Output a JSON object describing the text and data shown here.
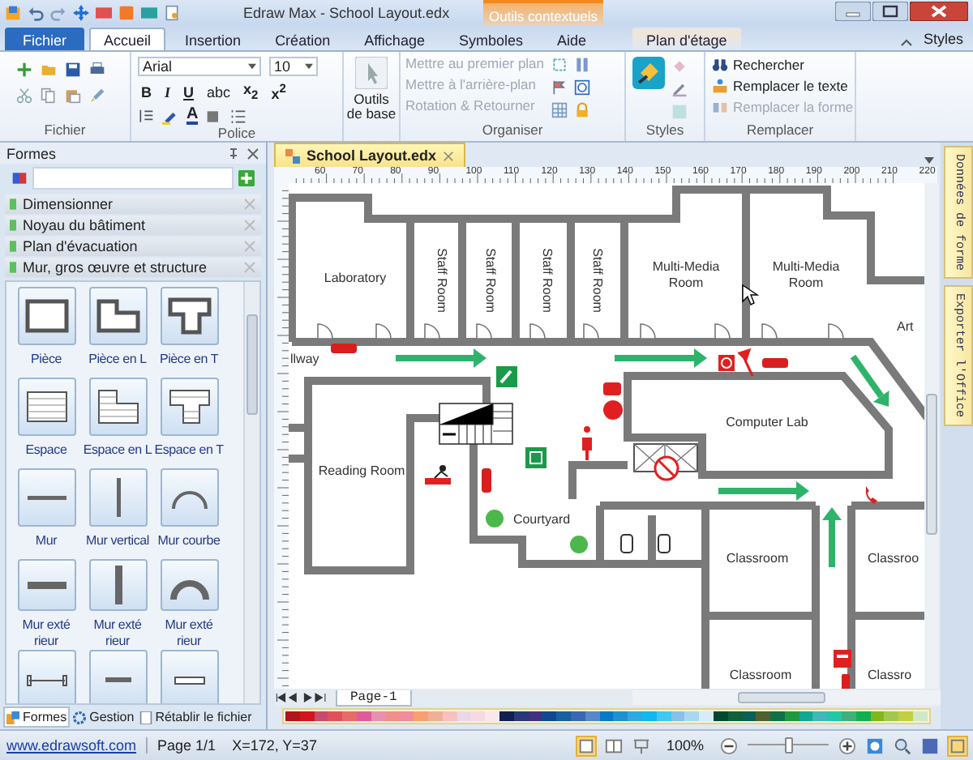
{
  "window": {
    "title": "Edraw Max - School Layout.edx",
    "context_label": "Outils contextuels"
  },
  "tabs": [
    {
      "label": "Fichier",
      "kind": "file",
      "selected": false
    },
    {
      "label": "Accueil",
      "kind": "tab",
      "selected": true
    },
    {
      "label": "Insertion",
      "kind": "tab",
      "selected": false
    },
    {
      "label": "Création",
      "kind": "tab",
      "selected": false
    },
    {
      "label": "Affichage",
      "kind": "tab",
      "selected": false
    },
    {
      "label": "Symboles",
      "kind": "tab",
      "selected": false
    },
    {
      "label": "Aide",
      "kind": "tab",
      "selected": false
    },
    {
      "label": "Plan d'étage",
      "kind": "context",
      "selected": false
    }
  ],
  "styles_button": "Styles",
  "ribbon": {
    "fichier": {
      "label": "Fichier"
    },
    "police": {
      "label": "Police",
      "font": "Arial",
      "size": "10",
      "format": [
        "B",
        "I",
        "U",
        "abc",
        "x$_{2}$",
        "x$^{2}$"
      ],
      "font_color": "A"
    },
    "outils": {
      "label": "Outils de base"
    },
    "organiser": {
      "label": "Organiser",
      "items": [
        {
          "label": "Mettre au premier plan",
          "disabled": true
        },
        {
          "label": "Mettre à l'arrière-plan",
          "disabled": true
        },
        {
          "label": "Rotation & Retourner",
          "disabled": true
        }
      ]
    },
    "styles": {
      "label": "Styles"
    },
    "remplacer": {
      "label": "Remplacer",
      "items": [
        {
          "label": "Rechercher",
          "disabled": false
        },
        {
          "label": "Remplacer le texte",
          "disabled": false
        },
        {
          "label": "Remplacer la forme",
          "disabled": true
        }
      ]
    }
  },
  "shapes_panel": {
    "title": "Formes",
    "categories": [
      "Dimensionner",
      "Noyau du bâtiment",
      "Plan d'évacuation",
      "Mur, gros œuvre et structure"
    ],
    "shapes": [
      {
        "label": "Pièce",
        "kind": "room"
      },
      {
        "label": "Pièce en L",
        "kind": "room-l"
      },
      {
        "label": "Pièce en T",
        "kind": "room-t"
      },
      {
        "label": "Espace",
        "kind": "space"
      },
      {
        "label": "Espace en L",
        "kind": "space-l"
      },
      {
        "label": "Espace en T",
        "kind": "space-t"
      },
      {
        "label": "Mur",
        "kind": "wall-h"
      },
      {
        "label": "Mur vertical",
        "kind": "wall-v"
      },
      {
        "label": "Mur courbe",
        "kind": "wall-arc"
      },
      {
        "label": "Mur exté rieur",
        "kind": "ext-h"
      },
      {
        "label": "Mur exté rieur",
        "kind": "ext-v"
      },
      {
        "label": "Mur exté rieur",
        "kind": "ext-arc"
      },
      {
        "kind": "dim"
      },
      {
        "kind": "bar"
      },
      {
        "kind": "slot"
      }
    ],
    "bottom_tabs": [
      {
        "label": "Formes",
        "selected": true
      },
      {
        "label": "Gestion",
        "selected": false
      },
      {
        "label": "Rétablir le fichier",
        "selected": false
      }
    ]
  },
  "document": {
    "tab": "School Layout.edx",
    "ruler": [
      "60",
      "70",
      "80",
      "90",
      "100",
      "110",
      "120",
      "130",
      "140",
      "150",
      "160",
      "170",
      "180",
      "190",
      "200",
      "210",
      "220"
    ],
    "rooms": [
      "Laboratory",
      "Staff Room",
      "Staff Room",
      "Staff Room",
      "Staff Room",
      "Multi-Media Room",
      "Multi-Media Room",
      "Art",
      "llway",
      "Reading Room",
      "Courtyard",
      "Computer Lab",
      "Classroom",
      "Classroom",
      "Classroo",
      "Classro"
    ],
    "page_tab": "Page-1",
    "palette": [
      {
        "color": "#b0141c"
      },
      {
        "color": "#d4141c"
      },
      {
        "color": "#c84a6e"
      },
      {
        "color": "#e0505a"
      },
      {
        "color": "#e86a6a"
      },
      {
        "color": "#e05a9a"
      },
      {
        "color": "#e890b0"
      },
      {
        "color": "#f09088"
      },
      {
        "color": "#f08c9c"
      },
      {
        "color": "#f8a070"
      },
      {
        "color": "#f0b098"
      },
      {
        "color": "#f8c0c0"
      },
      {
        "color": "#e8d8e8"
      },
      {
        "color": "#f8d8e4"
      },
      {
        "color": "#f8e8ee"
      },
      {
        "color": "#102050"
      },
      {
        "color": "#283878"
      },
      {
        "color": "#403080"
      },
      {
        "color": "#104890"
      },
      {
        "color": "#1860a0"
      },
      {
        "color": "#3868b0"
      },
      {
        "color": "#5888c8"
      },
      {
        "color": "#0878c8"
      },
      {
        "color": "#2090d0"
      },
      {
        "color": "#30a8e0"
      },
      {
        "color": "#10b8f0"
      },
      {
        "color": "#40c8f0"
      },
      {
        "color": "#88c0e8"
      },
      {
        "color": "#a8d8f0"
      },
      {
        "color": "#d8ecf8"
      },
      {
        "color": "#004830"
      },
      {
        "color": "#106038"
      },
      {
        "color": "#086058"
      },
      {
        "color": "#506030"
      },
      {
        "color": "#107048"
      },
      {
        "color": "#209840"
      },
      {
        "color": "#10a890"
      },
      {
        "color": "#40b8b8"
      },
      {
        "color": "#20c8a8"
      },
      {
        "color": "#40b078"
      },
      {
        "color": "#10b050"
      },
      {
        "color": "#80b818"
      },
      {
        "color": "#a0c850"
      },
      {
        "color": "#c0d040"
      },
      {
        "color": "#d0e8c8"
      }
    ]
  },
  "side_tabs": [
    "Données de forme",
    "Exporter l'Office"
  ],
  "status_bar": {
    "link": "www.edrawsoft.com",
    "page": "Page 1/1",
    "coords": "X=172, Y=37",
    "zoom": "100%",
    "zoom_slider": {
      "level": 0.5
    }
  }
}
